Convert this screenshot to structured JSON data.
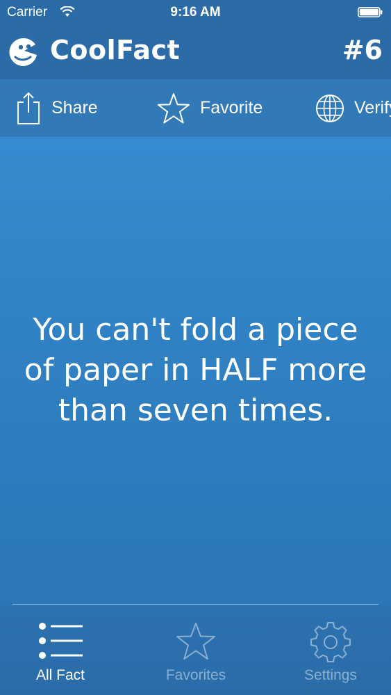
{
  "status_bar": {
    "carrier": "Carrier",
    "time": "9:16 AM"
  },
  "nav": {
    "app_title": "CoolFact",
    "fact_number": "#6"
  },
  "actions": {
    "share": "Share",
    "favorite": "Favorite",
    "verify": "Verify"
  },
  "fact": {
    "text": "You can't fold a piece of paper in HALF more than seven times."
  },
  "tabs": [
    {
      "label": "All Fact",
      "icon": "list-icon",
      "selected": true
    },
    {
      "label": "Favorites",
      "icon": "star-icon",
      "selected": false
    },
    {
      "label": "Settings",
      "icon": "gear-icon",
      "selected": false
    }
  ],
  "colors": {
    "background": "#3b93d6",
    "nav": "#2a6ba8",
    "action_bar": "#3279b8",
    "text": "#ffffff"
  }
}
